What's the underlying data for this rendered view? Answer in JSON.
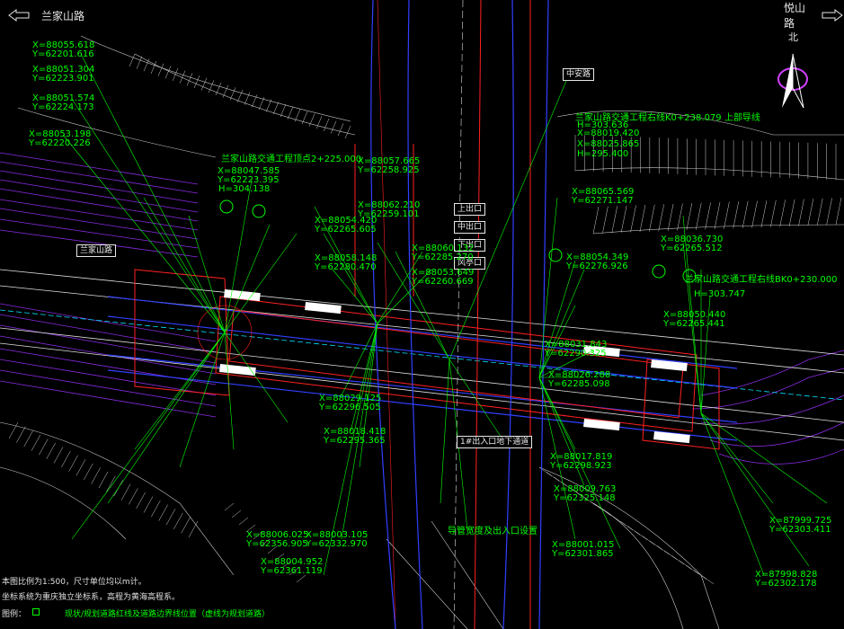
{
  "nav": {
    "left_road": "兰家山路",
    "right_road": "悦山路"
  },
  "compass": {
    "north_label": "北"
  },
  "colors": {
    "background": "#000000",
    "annotation": "#00ff00",
    "building": "#ff2020",
    "road_edge": "#3040ff",
    "contour": "#ffffff",
    "property_line": "#8a2be2",
    "cyan": "#00e0ff"
  },
  "callouts": {
    "top_station": "中安路",
    "left_station": "兰家山路",
    "left_entrance_title": "兰家山路交通工程顶点2+225.000",
    "right_entrance_title": "兰家山路交通工程右线BK0+230.000",
    "top_entrance_title": "兰家山路交通工程右线K0+238.079 上部导线",
    "bottom_label": "1#出入口地下通道",
    "bottom_note": "导管宽度及出入口设置",
    "center_boxes": [
      "上出口",
      "中出口",
      "下出口",
      "风亭口"
    ]
  },
  "coords": [
    {
      "x": "X=88055.618",
      "y": "Y=62201.616"
    },
    {
      "x": "X=88051.304",
      "y": "Y=62223.901"
    },
    {
      "x": "X=88051.574",
      "y": "Y=62224.173"
    },
    {
      "x": "X=88053.198",
      "y": "Y=62220.226"
    },
    {
      "x": "X=88047.585",
      "y": "Y=62223.395"
    },
    {
      "x": "X=88057.665",
      "y": "Y=62258.925"
    },
    {
      "x": "X=88062.210",
      "y": "Y=62259.101"
    },
    {
      "x": "X=88054.420",
      "y": "Y=62265.605"
    },
    {
      "x": "X=88058.148",
      "y": "Y=62280.470"
    },
    {
      "x": "X=88060.132",
      "y": "Y=62285.270"
    },
    {
      "x": "X=88053.649",
      "y": "Y=62260.669"
    },
    {
      "x": "X=88065.569",
      "y": "Y=62271.147"
    },
    {
      "x": "X=88054.349",
      "y": "Y=62276.926"
    },
    {
      "x": "X=88036.730",
      "y": "Y=62265.512"
    },
    {
      "x": "X=88050.440",
      "y": "Y=62265.441"
    },
    {
      "x": "X=88031.843",
      "y": "Y=62290.325"
    },
    {
      "x": "X=88026.288",
      "y": "Y=62285.098"
    },
    {
      "x": "X=88029.125",
      "y": "Y=62296.505"
    },
    {
      "x": "X=88018.418",
      "y": "Y=62295.365"
    },
    {
      "x": "X=88017.819",
      "y": "Y=62298.923"
    },
    {
      "x": "X=88009.763",
      "y": "Y=62325.148"
    },
    {
      "x": "X=88006.025",
      "y": "Y=62356.905"
    },
    {
      "x": "X=88004.952",
      "y": "Y=62361.119"
    },
    {
      "x": "X=88003.105",
      "y": "Y=62332.970"
    },
    {
      "x": "X=88001.015",
      "y": "Y=62301.865"
    },
    {
      "x": "X=87999.725",
      "y": "Y=62303.411"
    },
    {
      "x": "X=87998.828",
      "y": "Y=62302.178"
    }
  ],
  "elevation_notes": [
    "H=304.138",
    "H=303.636",
    "H=303.747",
    "H=295.400",
    "X=88019.420",
    "X=88025.865"
  ],
  "notes": {
    "line1": "本图比例为1:500，尺寸单位均以m计。",
    "line2": "坐标系统为重庆独立坐标系，高程为黄海高程系。",
    "line3": "图例：",
    "legend_text": "现状/规划道路红线及道路边界线位置（虚线为规划道路）"
  }
}
